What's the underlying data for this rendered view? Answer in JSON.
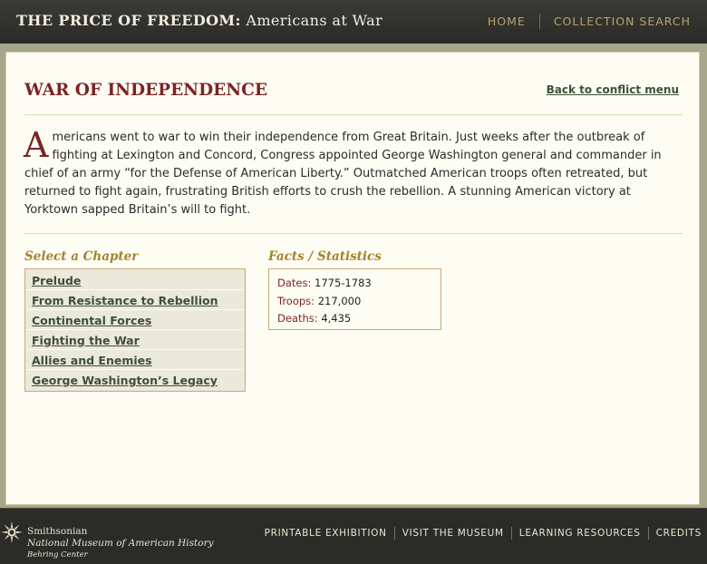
{
  "header": {
    "title_strong": "The Price of Freedom:",
    "title_rest": "Americans at War",
    "nav": [
      "HOME",
      "COLLECTION SEARCH"
    ]
  },
  "page": {
    "title": "WAR OF INDEPENDENCE",
    "back_link": "Back to conflict menu",
    "intro_dropcap": "A",
    "intro_text": "mericans went to war to win their independence from Great Britain. Just weeks after the outbreak of fighting at Lexington and Concord, Congress appointed George Washington general and commander in chief of an army “for the Defense of American Liberty.” Outmatched American troops often retreated, but returned to fight again, frustrating British efforts to crush the rebellion. A stunning American victory at Yorktown sapped Britain’s will to fight."
  },
  "chapters": {
    "heading": "Select a Chapter",
    "items": [
      "Prelude",
      "From Resistance to Rebellion",
      "Continental Forces",
      "Fighting the War",
      "Allies and Enemies",
      "George Washington’s Legacy"
    ]
  },
  "facts": {
    "heading": "Facts / Statistics",
    "rows": [
      {
        "label": "Dates:",
        "value": "1775-1783"
      },
      {
        "label": "Troops:",
        "value": "217,000"
      },
      {
        "label": "Deaths:",
        "value": "4,435"
      }
    ]
  },
  "footer": {
    "logo_line1": "Smithsonian",
    "logo_line2": "National Museum of American History",
    "logo_line3": "Behring Center",
    "logo_icon": "smithsonian-sun-icon",
    "nav": [
      "PRINTABLE EXHIBITION",
      "VISIT THE MUSEUM",
      "LEARNING RESOURCES",
      "CREDITS"
    ]
  }
}
